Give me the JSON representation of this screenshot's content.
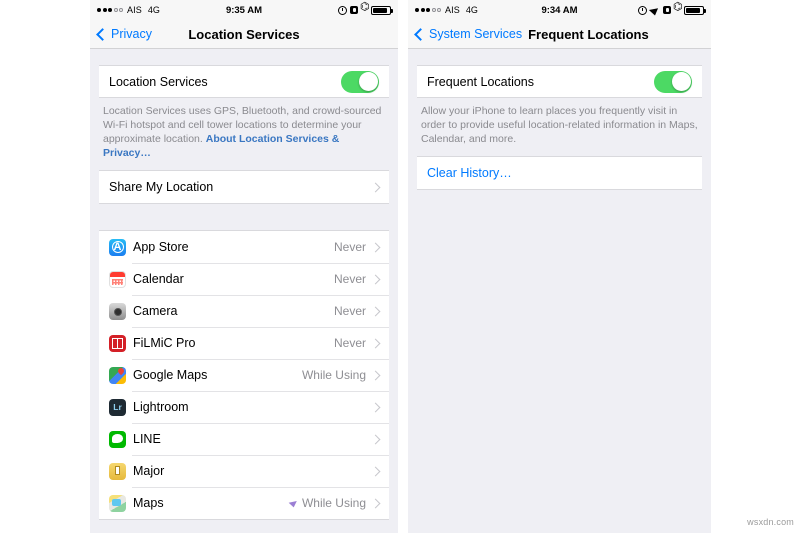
{
  "left_phone": {
    "status_bar": {
      "signal_filled": 3,
      "signal_hollow": 2,
      "carrier": "AIS",
      "network": "4G",
      "time": "9:35 AM",
      "icons": [
        "alarm-icon",
        "rotation-lock-icon",
        "bluetooth-icon",
        "battery-icon"
      ]
    },
    "nav": {
      "back_label": "Privacy",
      "title": "Location Services"
    },
    "master_switch": {
      "label": "Location Services",
      "state": "on"
    },
    "footer": {
      "text": "Location Services uses GPS, Bluetooth, and crowd-sourced Wi-Fi hotspot and cell tower locations to determine your approximate location. ",
      "link": "About Location Services & Privacy…"
    },
    "share_row": {
      "label": "Share My Location"
    },
    "apps": [
      {
        "name": "App Store",
        "value": "Never",
        "icon": "app-store-icon",
        "arrow": false
      },
      {
        "name": "Calendar",
        "value": "Never",
        "icon": "calendar-icon",
        "arrow": false
      },
      {
        "name": "Camera",
        "value": "Never",
        "icon": "camera-icon",
        "arrow": false
      },
      {
        "name": "FiLMiC Pro",
        "value": "Never",
        "icon": "filmic-pro-icon",
        "arrow": false
      },
      {
        "name": "Google Maps",
        "value": "While Using",
        "icon": "google-maps-icon",
        "arrow": false
      },
      {
        "name": "Lightroom",
        "value": "",
        "icon": "lightroom-icon",
        "arrow": false
      },
      {
        "name": "LINE",
        "value": "",
        "icon": "line-icon",
        "arrow": false
      },
      {
        "name": "Major",
        "value": "",
        "icon": "major-icon",
        "arrow": false
      },
      {
        "name": "Maps",
        "value": "While Using",
        "icon": "maps-icon",
        "arrow": true
      }
    ]
  },
  "right_phone": {
    "status_bar": {
      "signal_filled": 3,
      "signal_hollow": 2,
      "carrier": "AIS",
      "network": "4G",
      "time": "9:34 AM",
      "icons": [
        "alarm-icon",
        "location-arrow-icon",
        "rotation-lock-icon",
        "bluetooth-icon",
        "battery-icon"
      ]
    },
    "nav": {
      "back_label": "System Services",
      "title": "Frequent Locations"
    },
    "master_switch": {
      "label": "Frequent Locations",
      "state": "on"
    },
    "footer": {
      "text": "Allow your iPhone to learn places you frequently visit in order to provide useful location-related information in Maps, Calendar, and more."
    },
    "clear_row": {
      "label": "Clear History…"
    }
  },
  "watermark": "wsxdn.com",
  "colors": {
    "accent_blue": "#007aff",
    "toggle_green": "#4cd964",
    "background": "#efeff4",
    "value_gray": "#8e8e93",
    "maps_arrow_purple": "#9b7fd4"
  }
}
